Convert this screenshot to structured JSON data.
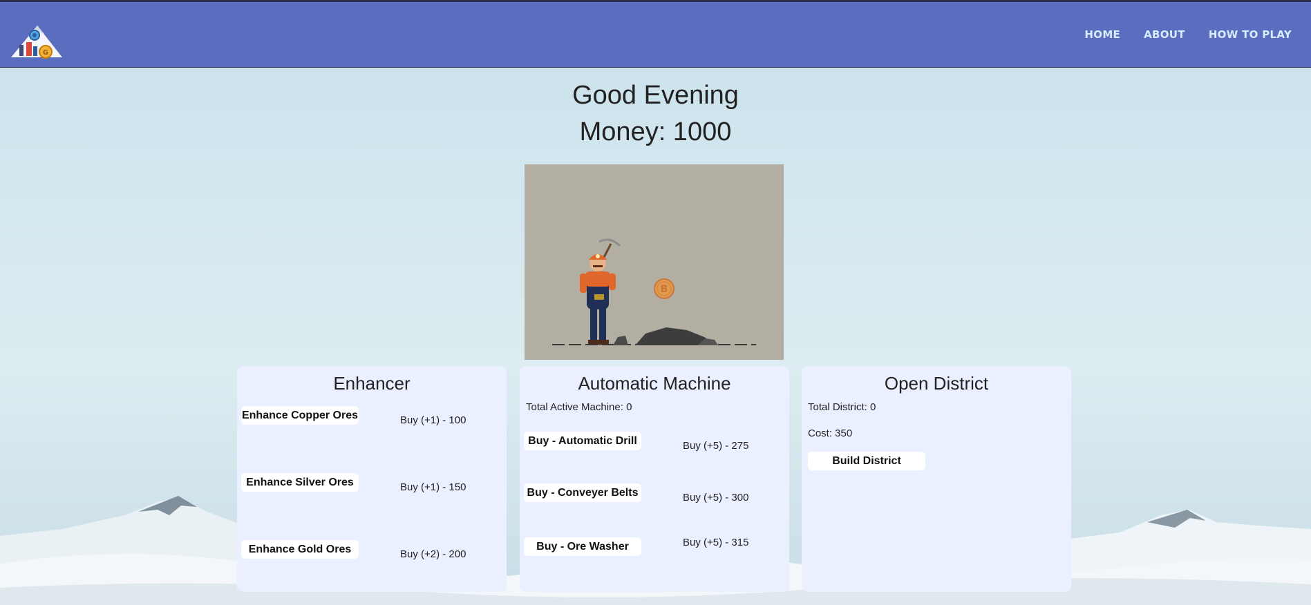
{
  "nav": {
    "items": [
      {
        "label": "HOME"
      },
      {
        "label": "ABOUT"
      },
      {
        "label": "HOW TO PLAY"
      }
    ]
  },
  "header": {
    "greeting": "Good Evening",
    "money": "Money: 1000"
  },
  "enhancer": {
    "title": "Enhancer",
    "items": [
      {
        "label": "Enhance Copper Ores",
        "price": "Buy (+1) - 100"
      },
      {
        "label": "Enhance Silver Ores",
        "price": "Buy (+1) - 150"
      },
      {
        "label": "Enhance Gold Ores",
        "price": "Buy (+2) - 200"
      }
    ]
  },
  "machine": {
    "title": "Automatic Machine",
    "total_active": "Total Active Machine: 0",
    "items": [
      {
        "label": "Buy - Automatic Drill",
        "price": "Buy (+5) - 275"
      },
      {
        "label": "Buy - Conveyer Belts",
        "price": "Buy (+5) - 300"
      },
      {
        "label": "Buy - Ore Washer",
        "price": "Buy (+5) - 315"
      }
    ]
  },
  "district": {
    "title": "Open District",
    "total": "Total District: 0",
    "cost": "Cost: 350",
    "button": "Build District"
  },
  "icons": {
    "logo": "miner-coin-logo-icon",
    "coin": "bitcoin-coin-icon",
    "miner": "miner-pickaxe-icon"
  },
  "colors": {
    "navbar": "#5a6dbf",
    "nav_text": "#d8ecff",
    "card_bg": "#eaf0ff",
    "scene_bg": "#b2afa2"
  }
}
